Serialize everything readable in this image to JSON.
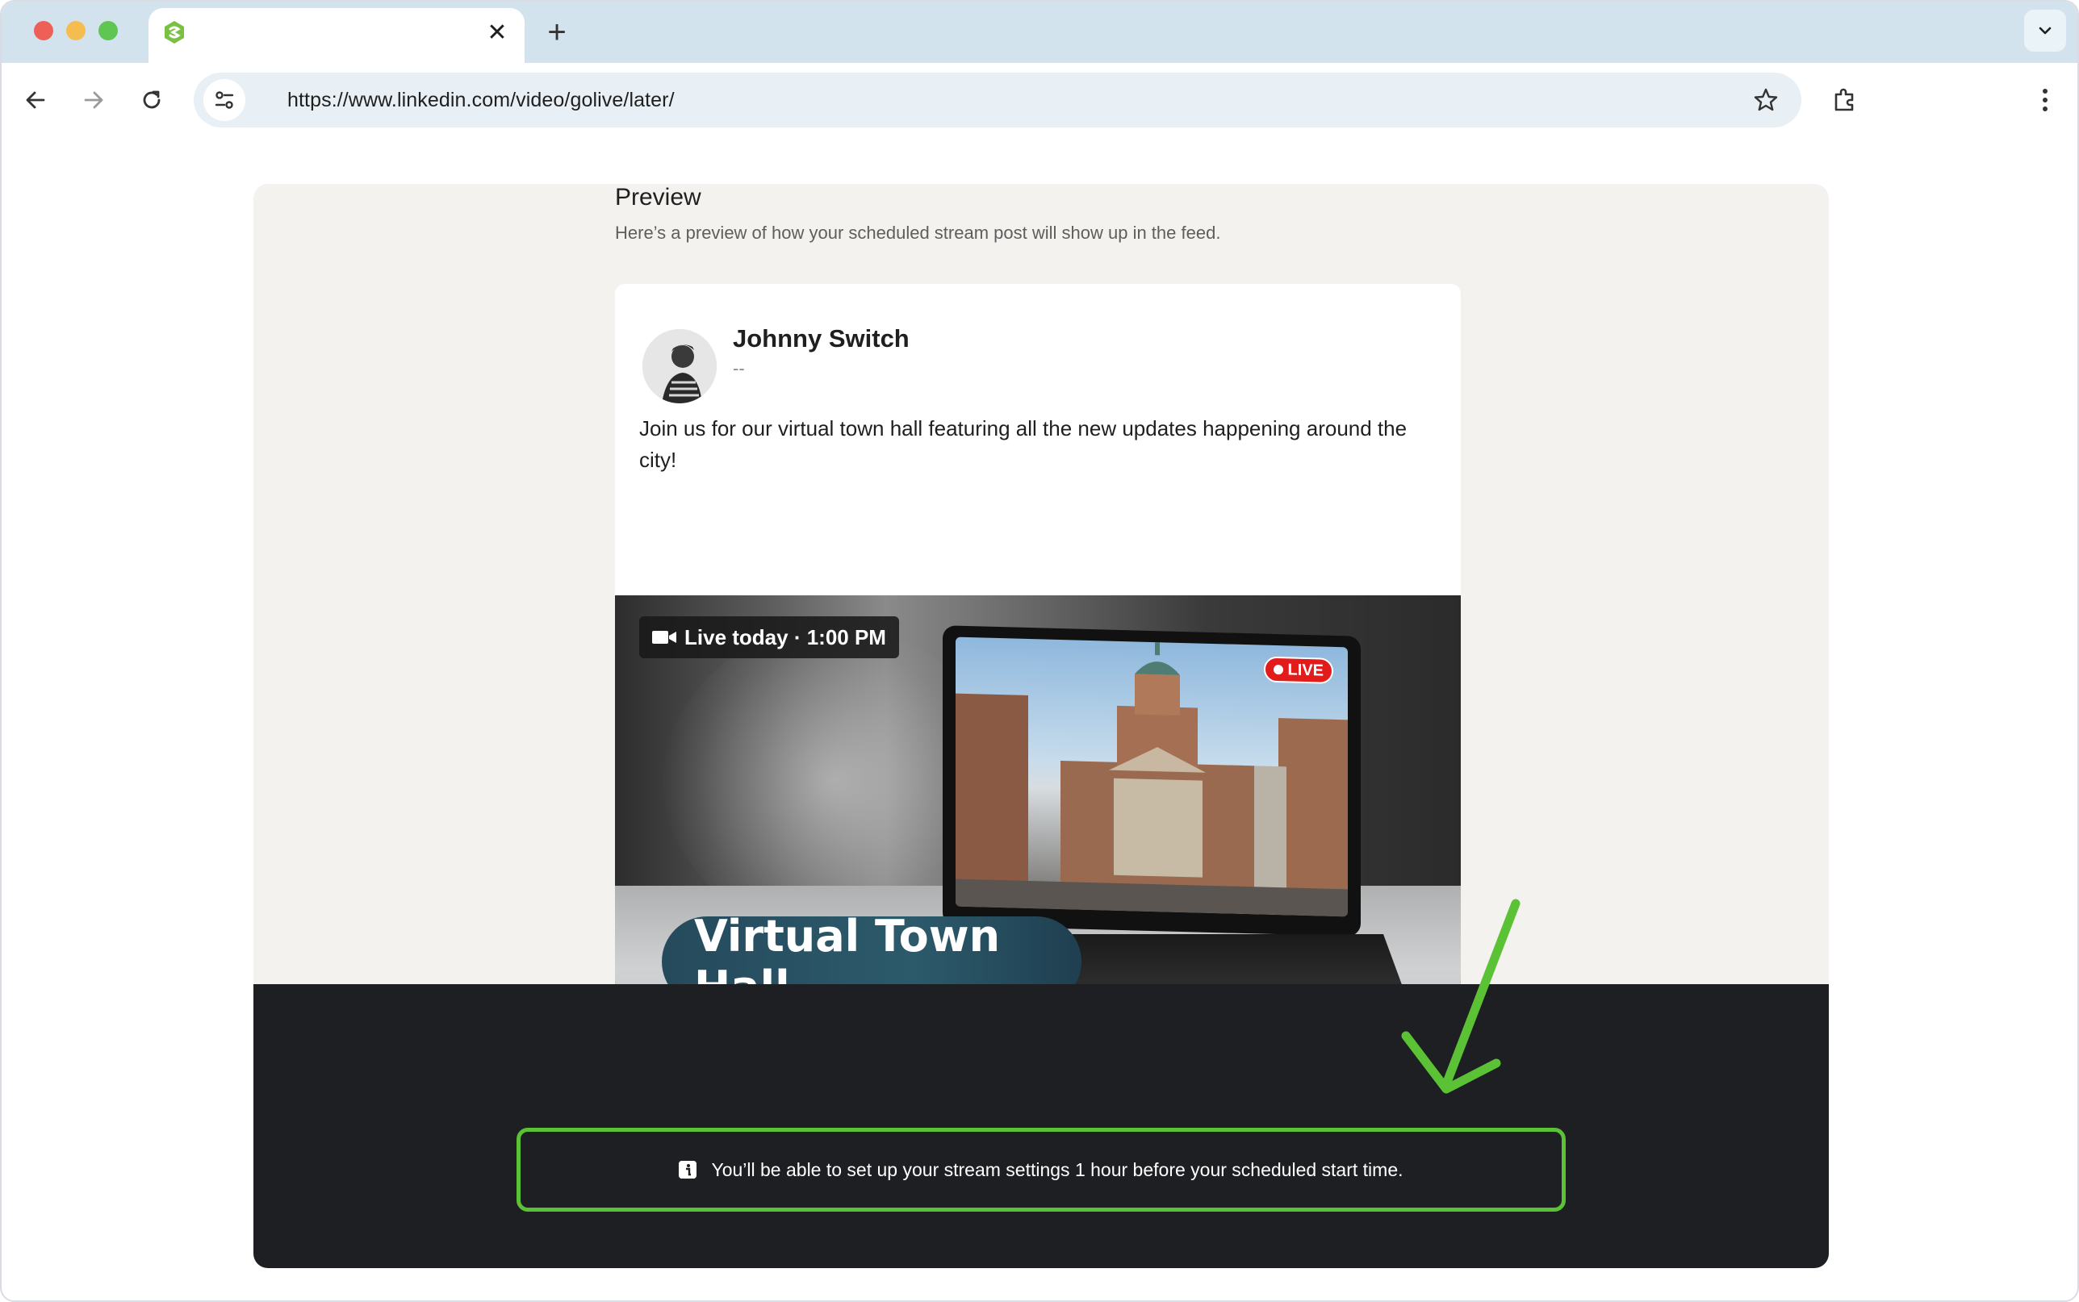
{
  "browser": {
    "url": "https://www.linkedin.com/video/golive/later/",
    "tab_close_glyph": "✕",
    "new_tab_glyph": "+",
    "icons": {
      "favicon": "app-favicon-icon",
      "back": "back-arrow-icon",
      "forward": "forward-arrow-icon",
      "reload": "reload-icon",
      "site_info": "site-settings-icon",
      "bookmark": "star-icon",
      "extensions": "extensions-icon",
      "menu": "kebab-menu-icon",
      "tab_search": "chevron-down-icon"
    }
  },
  "preview": {
    "title": "Preview",
    "subtitle": "Here’s a preview of how your scheduled stream post will show up in the feed."
  },
  "post": {
    "author_name": "Johnny Switch",
    "author_subtitle": "--",
    "body": "Join us for our virtual town hall featuring all the new updates happening around the city!",
    "live_badge": "Live today · 1:00 PM",
    "live_pill": "LIVE",
    "banner_title": "Virtual Town Hall"
  },
  "notice": {
    "text": "You’ll be able to set up your stream settings 1 hour before your scheduled start time."
  },
  "colors": {
    "highlight": "#5bc236",
    "dark_band": "#1d1f22",
    "live_red": "#e21b1b"
  }
}
